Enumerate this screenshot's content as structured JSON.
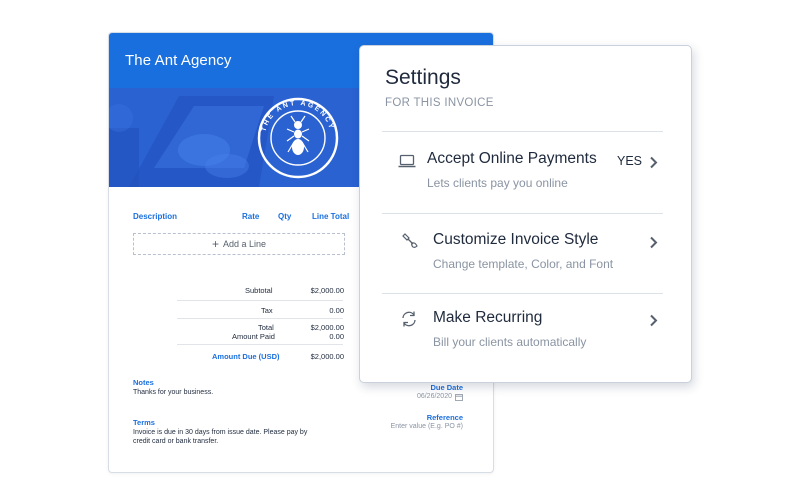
{
  "invoice": {
    "company_name": "The Ant Agency",
    "logo_text": "THE ANT AGENCY",
    "columns": {
      "description": "Description",
      "rate": "Rate",
      "qty": "Qty",
      "line_total": "Line Total"
    },
    "add_line_label": "Add a Line",
    "totals": {
      "subtotal_label": "Subtotal",
      "subtotal_value": "$2,000.00",
      "tax_label": "Tax",
      "tax_value": "0.00",
      "total_label": "Total",
      "total_value": "$2,000.00",
      "amount_paid_label": "Amount Paid",
      "amount_paid_value": "0.00",
      "amount_due_label": "Amount Due (USD)",
      "amount_due_value": "$2,000.00"
    },
    "notes": {
      "label": "Notes",
      "text": "Thanks for your business."
    },
    "terms": {
      "label": "Terms",
      "text": "Invoice is due in 30 days from issue date. Please pay by credit card or bank transfer."
    },
    "due_date": {
      "label": "Due Date",
      "value": "06/26/2020"
    },
    "reference": {
      "label": "Reference",
      "placeholder": "Enter value (E.g. PO #)"
    }
  },
  "settings": {
    "title": "Settings",
    "subtitle": "FOR THIS INVOICE",
    "options": [
      {
        "title": "Accept Online Payments",
        "description": "Lets clients pay you online",
        "value": "YES",
        "icon": "laptop-icon"
      },
      {
        "title": "Customize Invoice Style",
        "description": "Change template, Color, and Font",
        "icon": "paint-brush-icon"
      },
      {
        "title": "Make Recurring",
        "description": "Bill your clients automatically",
        "icon": "recurring-icon"
      }
    ]
  },
  "colors": {
    "brand_blue": "#1a6fde",
    "text_dark": "#1f2a3d",
    "text_muted": "#8a94a3"
  }
}
